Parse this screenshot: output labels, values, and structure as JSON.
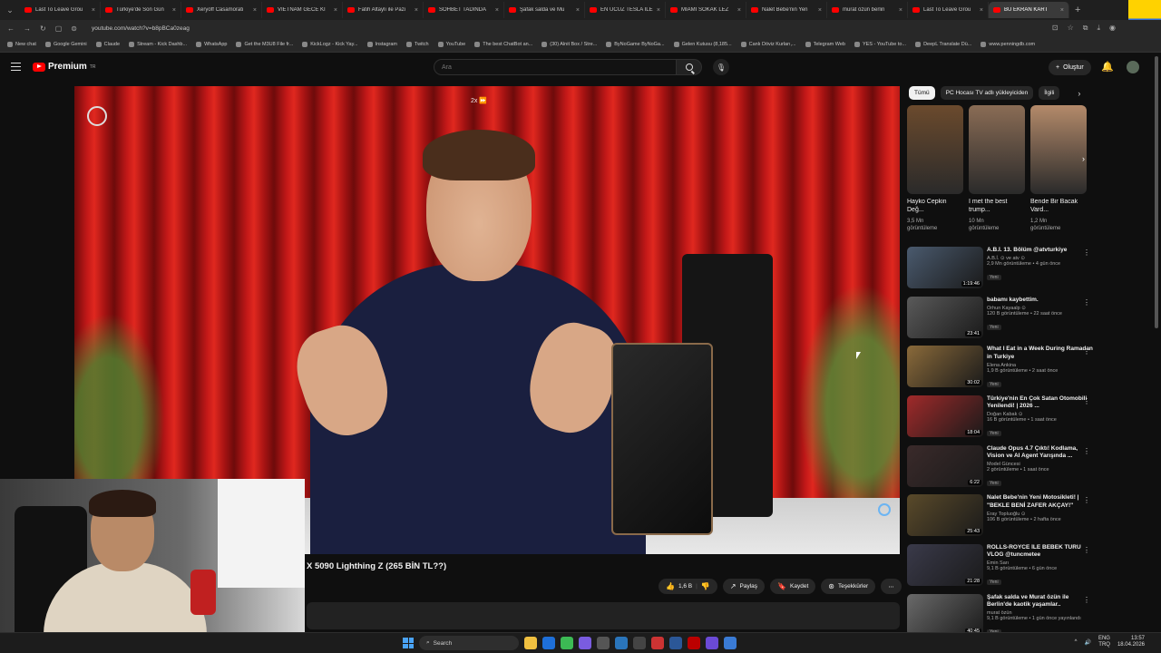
{
  "browser": {
    "tabs": [
      {
        "title": "Last To Leave Grou"
      },
      {
        "title": "Türkiye'de Son Gün"
      },
      {
        "title": "Xeryoff Casamorati"
      },
      {
        "title": "VIETNAM GECE KI"
      },
      {
        "title": "Fatih Altaylı ile Pazı"
      },
      {
        "title": "SOHBET TADINDA"
      },
      {
        "title": "Şafak salda ve Mu"
      },
      {
        "title": "EN UCUZ TESLA İLE"
      },
      {
        "title": "MİAMİ SOKAK LEZ"
      },
      {
        "title": "Nalet Bebe'nin Yen"
      },
      {
        "title": "murat özün berlin"
      },
      {
        "title": "Last To Leave Grou"
      },
      {
        "title": "BU EKRAN KART",
        "active": true
      }
    ],
    "url": "youtube.com/watch?v=b8pBCa0zeag",
    "bookmarks": [
      "New chat",
      "Google Gemini",
      "Claude",
      "Stream - Kick Dashb...",
      "WhatsApp",
      "Get the M3U8 File fr...",
      "KickLogz - Kick Yay...",
      "Instagram",
      "Twitch",
      "YouTube",
      "The best ChatBot an...",
      "(30) Alnit Box / Stre...",
      "ByNoGame ByNoGa...",
      "Gelen Kutusu (8,185...",
      "Canlı Döviz Kurları,...",
      "Telegram Web",
      "YES - YouTube to...",
      "DeepL Translate Dü...",
      "www.penningdb.com"
    ]
  },
  "header": {
    "logo_text": "Premium",
    "logo_sup": "TR",
    "search_placeholder": "Ara",
    "create_label": "Oluştur"
  },
  "player": {
    "speed_label": "2x ⏩"
  },
  "video": {
    "title": "X 5090 Lighthing Z (265 BİN TL??)",
    "actions": {
      "like_count": "1,6 B",
      "share": "Paylaş",
      "save": "Kaydet",
      "thanks": "Teşekkürler"
    }
  },
  "chips": [
    "Tümü",
    "PC Hocası TV adlı yükleyiciden",
    "İlgili"
  ],
  "shorts": [
    {
      "title": "Hayko Cepkin Değ...",
      "views": "3,5 Mn",
      "views_label": "görüntüleme",
      "color": "#6b4a2d"
    },
    {
      "title": "I met the best trump...",
      "views": "10 Mn",
      "views_label": "görüntüleme",
      "color": "#8a6c55"
    },
    {
      "title": "Bende Bir Bacak Vard...",
      "views": "1,2 Mn",
      "views_label": "görüntüleme",
      "color": "#b48a6a"
    }
  ],
  "recommendations": [
    {
      "title": "A.B.İ. 13. Bölüm @atvturkiye",
      "channel": "A.B.İ. ⊙ ve atv ⊙",
      "meta": "2,9 Mn görüntüleme • 4 gün önce",
      "badge": "Yeni",
      "duration": "1:19:46",
      "color": "#4a5a6e"
    },
    {
      "title": "babamı kaybettim.",
      "channel": "Orhun Kayaalp ⊙",
      "meta": "120 B görüntüleme • 22 saat önce",
      "badge": "Yeni",
      "duration": "23:41",
      "color": "#5a5a5a"
    },
    {
      "title": "What I Eat in a Week During Ramadan in Turkiye",
      "channel": "Elena Ankina",
      "meta": "1,9 B görüntüleme • 2 saat önce",
      "badge": "Yeni",
      "duration": "30:02",
      "color": "#8a6a3a"
    },
    {
      "title": "Türkiye'nin En Çok Satan Otomobili Yenilendi! | 2026 ...",
      "channel": "Doğan Kabak ⊙",
      "meta": "16 B görüntüleme • 1 saat önce",
      "badge": "Yeni",
      "duration": "18:04",
      "color": "#a02a2a"
    },
    {
      "title": "Claude Opus 4.7 Çıktı! Kodlama, Vision ve AI Agent Yarışında ...",
      "channel": "Model Güncesi",
      "meta": "2 görüntüleme • 1 saat önce",
      "badge": "Yeni",
      "duration": "6:22",
      "color": "#3a2a2a"
    },
    {
      "title": "Nalet Bebe'nin Yeni Motosikleti! | \"BEKLE BENİ ZAFER AKÇAY!\"",
      "channel": "Eray Topluoğlu ⊙",
      "meta": "106 B görüntüleme • 2 hafta önce",
      "badge": "",
      "duration": "25:43",
      "color": "#5a4a2a"
    },
    {
      "title": "ROLLS-ROYCE İLE BEBEK TURU VLOG @tuncmetee",
      "channel": "Emin Sarı",
      "meta": "9,1 B görüntüleme • 6 gün önce",
      "badge": "Yeni",
      "duration": "21:28",
      "color": "#3a3a4a"
    },
    {
      "title": "Şafak salda ve Murat özün ile Berlin'de kaotik yaşamlar..",
      "channel": "murat özün",
      "meta": "9,1 B görüntüleme • 1 gün önce yayınlandı",
      "badge": "Yeni",
      "duration": "40:45",
      "color": "#6a6a6a"
    }
  ],
  "taskbar": {
    "search_placeholder": "Search",
    "lang_top": "ENG",
    "lang_bottom": "TRQ",
    "time": "13:57",
    "date": "18.04.2026"
  }
}
